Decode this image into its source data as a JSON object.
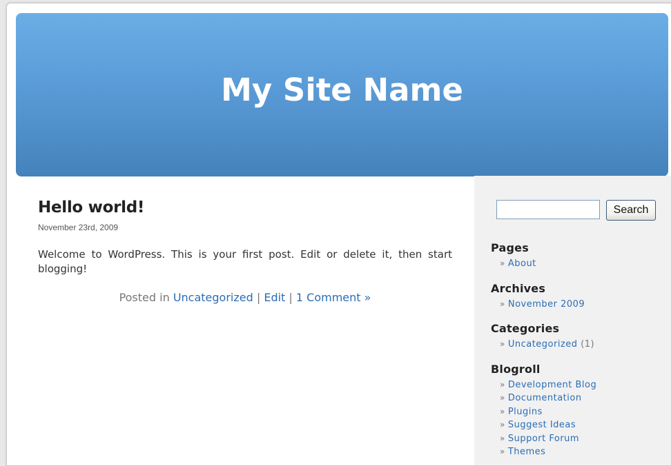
{
  "site": {
    "title": "My Site Name"
  },
  "post": {
    "title": "Hello world!",
    "date": "November 23rd, 2009",
    "content": "Welcome to WordPress. This is your first post. Edit or delete it, then start blogging!",
    "meta": {
      "posted_in": "Posted in",
      "category": "Uncategorized",
      "separator": "|",
      "edit": "Edit",
      "comments": "1 Comment »"
    }
  },
  "sidebar": {
    "search": {
      "value": "",
      "button_label": "Search"
    },
    "raquo": "»",
    "pages": {
      "heading": "Pages",
      "items": [
        "About"
      ]
    },
    "archives": {
      "heading": "Archives",
      "items": [
        "November 2009"
      ]
    },
    "categories": {
      "heading": "Categories",
      "items": [
        {
          "label": "Uncategorized",
          "count": "(1)"
        }
      ]
    },
    "blogroll": {
      "heading": "Blogroll",
      "items": [
        "Development Blog",
        "Documentation",
        "Plugins",
        "Suggest Ideas",
        "Support Forum",
        "Themes"
      ]
    }
  },
  "colors": {
    "header_top": "#6aaee6",
    "header_bottom": "#4482bb",
    "link": "#2a6db5",
    "sidebar_bg": "#f1f1f1"
  }
}
